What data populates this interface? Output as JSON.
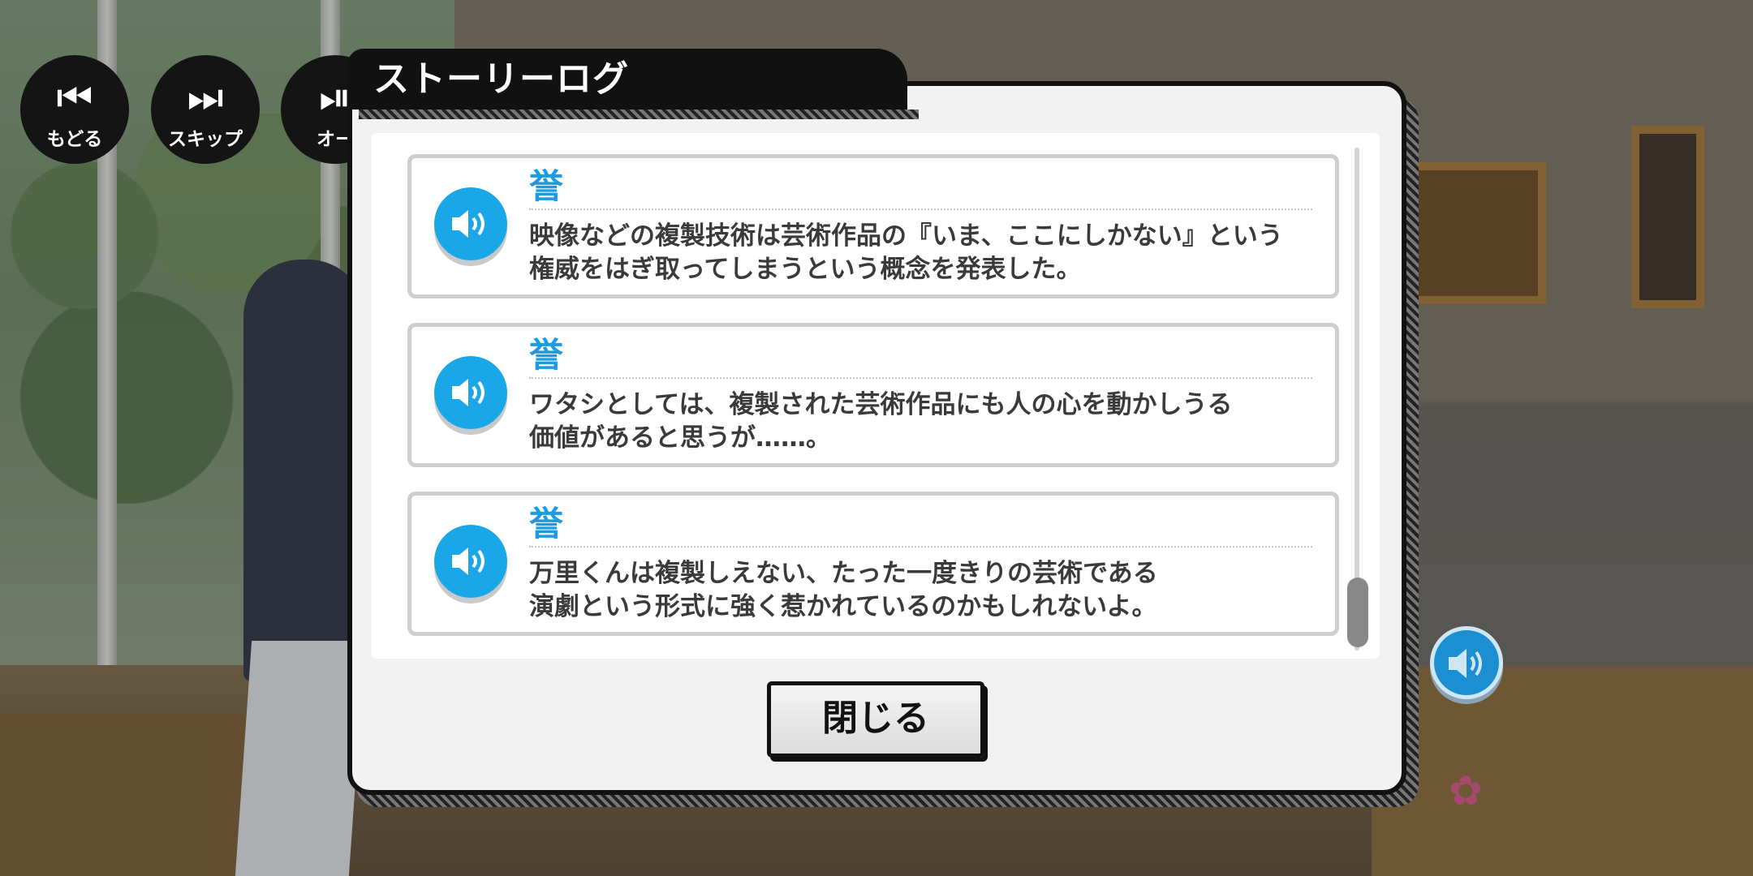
{
  "controls": [
    {
      "icon": "back-icon",
      "glyph": "⏮",
      "label": "もどる"
    },
    {
      "icon": "skip-icon",
      "glyph": "⏭",
      "label": "スキップ"
    },
    {
      "icon": "auto-icon",
      "glyph": "⏯",
      "label": "オー"
    }
  ],
  "dialog": {
    "title": "ストーリーログ",
    "close_label": "閉じる"
  },
  "log_entries": [
    {
      "speaker": "誉",
      "line1": "映像などの複製技術は芸術作品の『いま、ここにしかない』という",
      "line2": "権威をはぎ取ってしまうという概念を発表した。"
    },
    {
      "speaker": "誉",
      "line1": "ワタシとしては、複製された芸術作品にも人の心を動かしうる",
      "line2": "価値があると思うが……。"
    },
    {
      "speaker": "誉",
      "line1": "万里くんは複製しえない、たった一度きりの芸術である",
      "line2": "演劇という形式に強く惹かれているのかもしれないよ。"
    }
  ],
  "colors": {
    "speaker": "#1a9be6",
    "voice_button": "#1aa7e8",
    "panel_border": "#111111"
  }
}
